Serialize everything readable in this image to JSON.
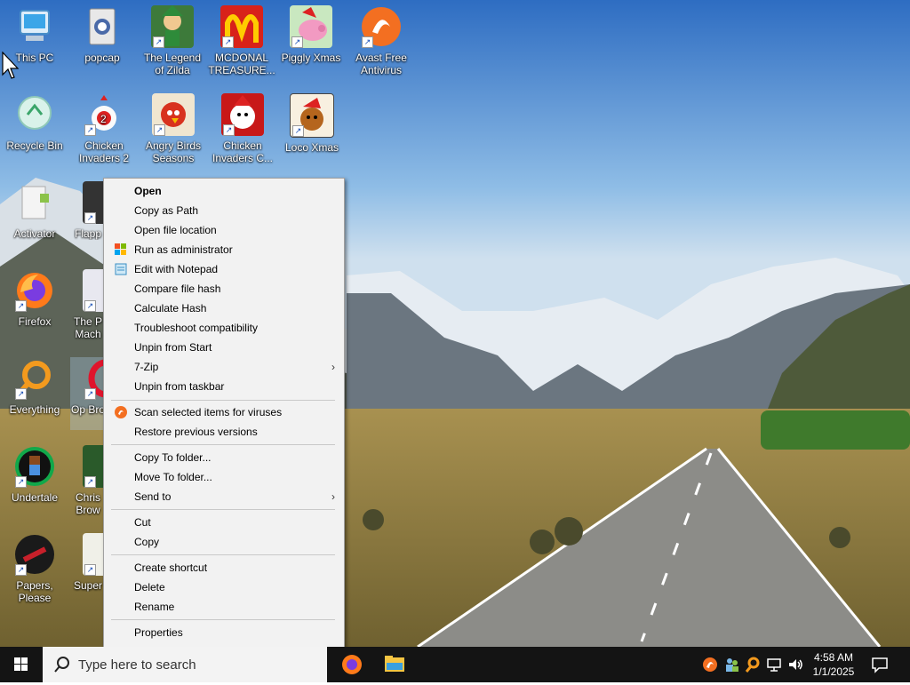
{
  "desktop": {
    "icons": [
      {
        "label": "This PC",
        "icon": "this-pc-icon"
      },
      {
        "label": "popcap",
        "icon": "popcap-folder-icon"
      },
      {
        "label": "The Legend of Zilda",
        "icon": "zelda-game-icon"
      },
      {
        "label": "MCDONAL TREASURE...",
        "icon": "mcdonald-game-icon"
      },
      {
        "label": "Piggly Xmas",
        "icon": "piggly-xmas-icon"
      },
      {
        "label": "Avast Free Antivirus",
        "icon": "avast-icon"
      },
      {
        "label": "Recycle Bin",
        "icon": "recycle-bin-icon"
      },
      {
        "label": "Chicken Invaders 2",
        "icon": "chicken-invaders-2-icon"
      },
      {
        "label": "Angry Birds Seasons",
        "icon": "angry-birds-icon"
      },
      {
        "label": "Chicken Invaders C...",
        "icon": "chicken-invaders-c-icon"
      },
      {
        "label": "Loco Xmas",
        "icon": "loco-xmas-icon"
      },
      {
        "label": "Activator",
        "icon": "activator-icon"
      },
      {
        "label": "Flapp",
        "icon": "flappy-icon"
      },
      {
        "label": "Firefox",
        "icon": "firefox-icon"
      },
      {
        "label": "The P Mach",
        "icon": "pinball-icon"
      },
      {
        "label": "Everything",
        "icon": "everything-icon"
      },
      {
        "label": "Op Bro",
        "icon": "opera-icon"
      },
      {
        "label": "Undertale",
        "icon": "undertale-icon"
      },
      {
        "label": "Chris Brow",
        "icon": "chris-icon"
      },
      {
        "label": "Papers, Please",
        "icon": "papers-please-icon"
      },
      {
        "label": "Super",
        "icon": "super-icon"
      }
    ]
  },
  "context_menu": {
    "items": [
      {
        "label": "Open",
        "bold": true
      },
      {
        "label": "Copy as Path"
      },
      {
        "label": "Open file location"
      },
      {
        "label": "Run as administrator",
        "icon": "shield-icon"
      },
      {
        "label": "Edit with Notepad",
        "icon": "notepad-icon"
      },
      {
        "label": "Compare file hash"
      },
      {
        "label": "Calculate Hash"
      },
      {
        "label": "Troubleshoot compatibility"
      },
      {
        "label": "Unpin from Start"
      },
      {
        "label": "7-Zip",
        "submenu": true
      },
      {
        "label": "Unpin from taskbar"
      },
      {
        "label": "Scan selected items for viruses",
        "icon": "avast-icon"
      },
      {
        "label": "Restore previous versions"
      },
      {
        "label": "Copy To folder..."
      },
      {
        "label": "Move To folder..."
      },
      {
        "label": "Send to",
        "submenu": true
      },
      {
        "label": "Cut"
      },
      {
        "label": "Copy"
      },
      {
        "label": "Create shortcut"
      },
      {
        "label": "Delete"
      },
      {
        "label": "Rename"
      },
      {
        "label": "Properties"
      }
    ],
    "submenu_glyph": "›"
  },
  "taskbar": {
    "search_placeholder": "Type here to search",
    "apps": [
      "firefox-icon",
      "file-explorer-icon"
    ],
    "tray": [
      "avast-tray-icon",
      "people-icon",
      "search-tool-icon",
      "network-icon",
      "volume-icon"
    ],
    "time": "4:58 AM",
    "date": "1/1/2025",
    "notification_icon": "notification-icon"
  },
  "colors": {
    "menu_bg": "#f2f2f2",
    "taskbar_bg": "#141414",
    "sky": "#4f8fd8"
  }
}
